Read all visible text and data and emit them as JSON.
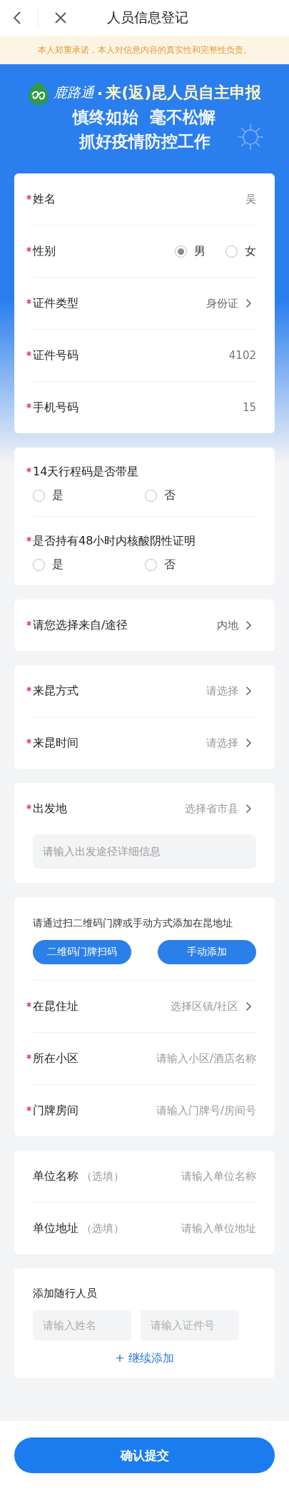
{
  "nav": {
    "title": "人员信息登记"
  },
  "notice": "本人郑重承诺，本人对信息内容的真实性和完整性负责。",
  "banner": {
    "brand": "鹿路通",
    "separator": "·",
    "title": "来(返)昆人员自主申报",
    "slogans": [
      "慎终如始  毫不松懈",
      "抓好疫情防控工作"
    ]
  },
  "cards": [
    {
      "rows": [
        {
          "kind": "field",
          "label": "姓名",
          "required": true,
          "value": "吴",
          "chevron": false
        },
        {
          "kind": "radio",
          "label": "性别",
          "required": true,
          "options": [
            {
              "label": "男",
              "selected": true
            },
            {
              "label": "女",
              "selected": false
            }
          ]
        },
        {
          "kind": "field",
          "label": "证件类型",
          "required": true,
          "value": "身份证",
          "chevron": true
        },
        {
          "kind": "field",
          "label": "证件号码",
          "required": true,
          "value": "4102",
          "chevron": false
        },
        {
          "kind": "field",
          "label": "手机号码",
          "required": true,
          "value": "15",
          "chevron": false
        }
      ]
    },
    {
      "rows": [
        {
          "kind": "question",
          "label": "14天行程码是否带星",
          "required": true,
          "options": [
            {
              "label": "是",
              "selected": false
            },
            {
              "label": "否",
              "selected": false
            }
          ]
        },
        {
          "kind": "question",
          "label": "是否持有48小时内核酸阴性证明",
          "required": true,
          "options": [
            {
              "label": "是",
              "selected": false
            },
            {
              "label": "否",
              "selected": false
            }
          ]
        }
      ]
    },
    {
      "rows": [
        {
          "kind": "field",
          "label": "请您选择来自/途径",
          "required": true,
          "value": "内地",
          "chevron": true
        }
      ]
    },
    {
      "rows": [
        {
          "kind": "field",
          "label": "来昆方式",
          "required": true,
          "placeholder": "请选择",
          "chevron": true
        },
        {
          "kind": "field",
          "label": "来昆时间",
          "required": true,
          "placeholder": "请选择",
          "chevron": true
        }
      ]
    },
    {
      "rows": [
        {
          "kind": "field",
          "label": "出发地",
          "required": true,
          "placeholder": "选择省市县",
          "chevron": true
        },
        {
          "kind": "detail",
          "placeholder": "请输入出发途径详细信息"
        }
      ]
    },
    {
      "rows": [
        {
          "kind": "prompt",
          "text": "请通过扫二维码门牌或手动方式添加在昆地址",
          "buttons": [
            "二维码门牌扫码",
            "手动添加"
          ]
        },
        {
          "kind": "field",
          "label": "在昆住址",
          "required": true,
          "placeholder": "选择区镇/社区",
          "chevron": true
        },
        {
          "kind": "field",
          "label": "所在小区",
          "required": true,
          "placeholder": "请输入小区/酒店名称",
          "chevron": false
        },
        {
          "kind": "field",
          "label": "门牌房间",
          "required": true,
          "placeholder": "请输入门牌号/房间号",
          "chevron": false
        }
      ]
    },
    {
      "rows": [
        {
          "kind": "field",
          "label": "单位名称",
          "hint": "（选填）",
          "required": false,
          "placeholder": "请输入单位名称",
          "chevron": false
        },
        {
          "kind": "field",
          "label": "单位地址",
          "hint": "（选填）",
          "required": false,
          "placeholder": "请输入单位地址",
          "chevron": false
        }
      ]
    },
    {
      "rows": [
        {
          "kind": "companions",
          "title": "添加随行人员",
          "placeholders": [
            "请输入姓名",
            "请输入证件号"
          ],
          "add": "+ 继续添加"
        }
      ]
    }
  ],
  "submit": "确认提交"
}
